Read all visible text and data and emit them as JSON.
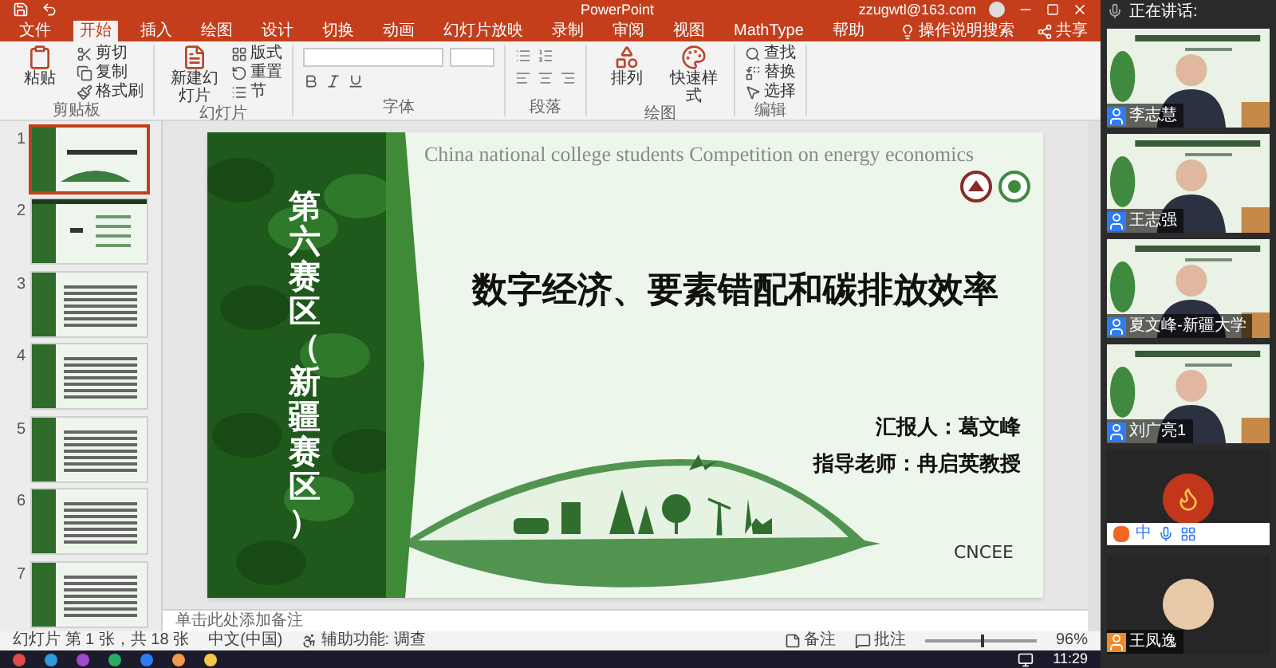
{
  "window": {
    "title": "PowerPoint",
    "account": "zzugwtl@163.com",
    "share": "共享"
  },
  "ribbon_tabs": [
    {
      "label": "文件",
      "selected": false
    },
    {
      "label": "开始",
      "selected": true
    },
    {
      "label": "插入",
      "selected": false
    },
    {
      "label": "绘图",
      "selected": false
    },
    {
      "label": "设计",
      "selected": false
    },
    {
      "label": "切换",
      "selected": false
    },
    {
      "label": "动画",
      "selected": false
    },
    {
      "label": "幻灯片放映",
      "selected": false
    },
    {
      "label": "录制",
      "selected": false
    },
    {
      "label": "审阅",
      "selected": false
    },
    {
      "label": "视图",
      "selected": false
    },
    {
      "label": "MathType",
      "selected": false
    },
    {
      "label": "帮助",
      "selected": false
    }
  ],
  "tell_me": "操作说明搜索",
  "ribbon_groups": [
    {
      "label": "剪贴板",
      "kind": "items",
      "items": [
        {
          "label": "粘贴",
          "kind": "large"
        },
        {
          "label": "剪切",
          "kind": "small"
        },
        {
          "label": "复制",
          "kind": "small"
        },
        {
          "label": "格式刷",
          "kind": "small"
        }
      ]
    },
    {
      "label": "幻灯片",
      "kind": "items",
      "items": [
        {
          "label": "新建幻灯片",
          "kind": "large"
        },
        {
          "label": "版式",
          "kind": "small"
        },
        {
          "label": "重置",
          "kind": "small"
        },
        {
          "label": "节",
          "kind": "small"
        }
      ]
    },
    {
      "label": "字体",
      "kind": "font"
    },
    {
      "label": "段落",
      "kind": "paragraph"
    },
    {
      "label": "绘图",
      "kind": "items",
      "items": [
        {
          "label": "排列",
          "kind": "large"
        },
        {
          "label": "快速样式",
          "kind": "large"
        }
      ]
    },
    {
      "label": "编辑",
      "kind": "items",
      "items": [
        {
          "label": "查找",
          "kind": "small"
        },
        {
          "label": "替换",
          "kind": "small"
        },
        {
          "label": "选择",
          "kind": "small"
        }
      ]
    }
  ],
  "thumbnails": [
    {
      "number": "1",
      "selected": true,
      "kind": "title"
    },
    {
      "number": "2",
      "selected": false,
      "kind": "contents"
    },
    {
      "number": "3",
      "selected": false,
      "kind": "text"
    },
    {
      "number": "4",
      "selected": false,
      "kind": "text"
    },
    {
      "number": "5",
      "selected": false,
      "kind": "text"
    },
    {
      "number": "6",
      "selected": false,
      "kind": "text"
    },
    {
      "number": "7",
      "selected": false,
      "kind": "text"
    }
  ],
  "slide": {
    "watermark": "China national college students Competition on energy economics",
    "side_title": "第六赛区（新疆赛区）",
    "title": "数字经济、要素错配和碳排放效率",
    "reporter": "汇报人：葛文峰",
    "advisor": "指导老师：冉启英教授",
    "brand": "CNCEE"
  },
  "notes_placeholder": "单击此处添加备注",
  "status_bar": {
    "slide_info": "幻灯片 第 1 张，共 18 张",
    "language": "中文(中国)",
    "accessibility": "辅助功能: 调查",
    "notes": "备注",
    "comments": "批注",
    "zoom": "96%",
    "zoom_slider": {
      "level": 0.5
    }
  },
  "taskbar": {
    "time": "11:29"
  },
  "meeting": {
    "speaking_label": "正在讲话:",
    "ime": "中",
    "participants": [
      {
        "name": "李志慧",
        "kind": "video"
      },
      {
        "name": "王志强",
        "kind": "video"
      },
      {
        "name": "夏文峰-新疆大学",
        "kind": "video"
      },
      {
        "name": "刘广亮1",
        "kind": "video"
      },
      {
        "kind": "avatar",
        "color": "#c2361c"
      },
      {
        "name": "王凤逸",
        "kind": "avatar",
        "color": "#e8c9a8"
      }
    ]
  }
}
